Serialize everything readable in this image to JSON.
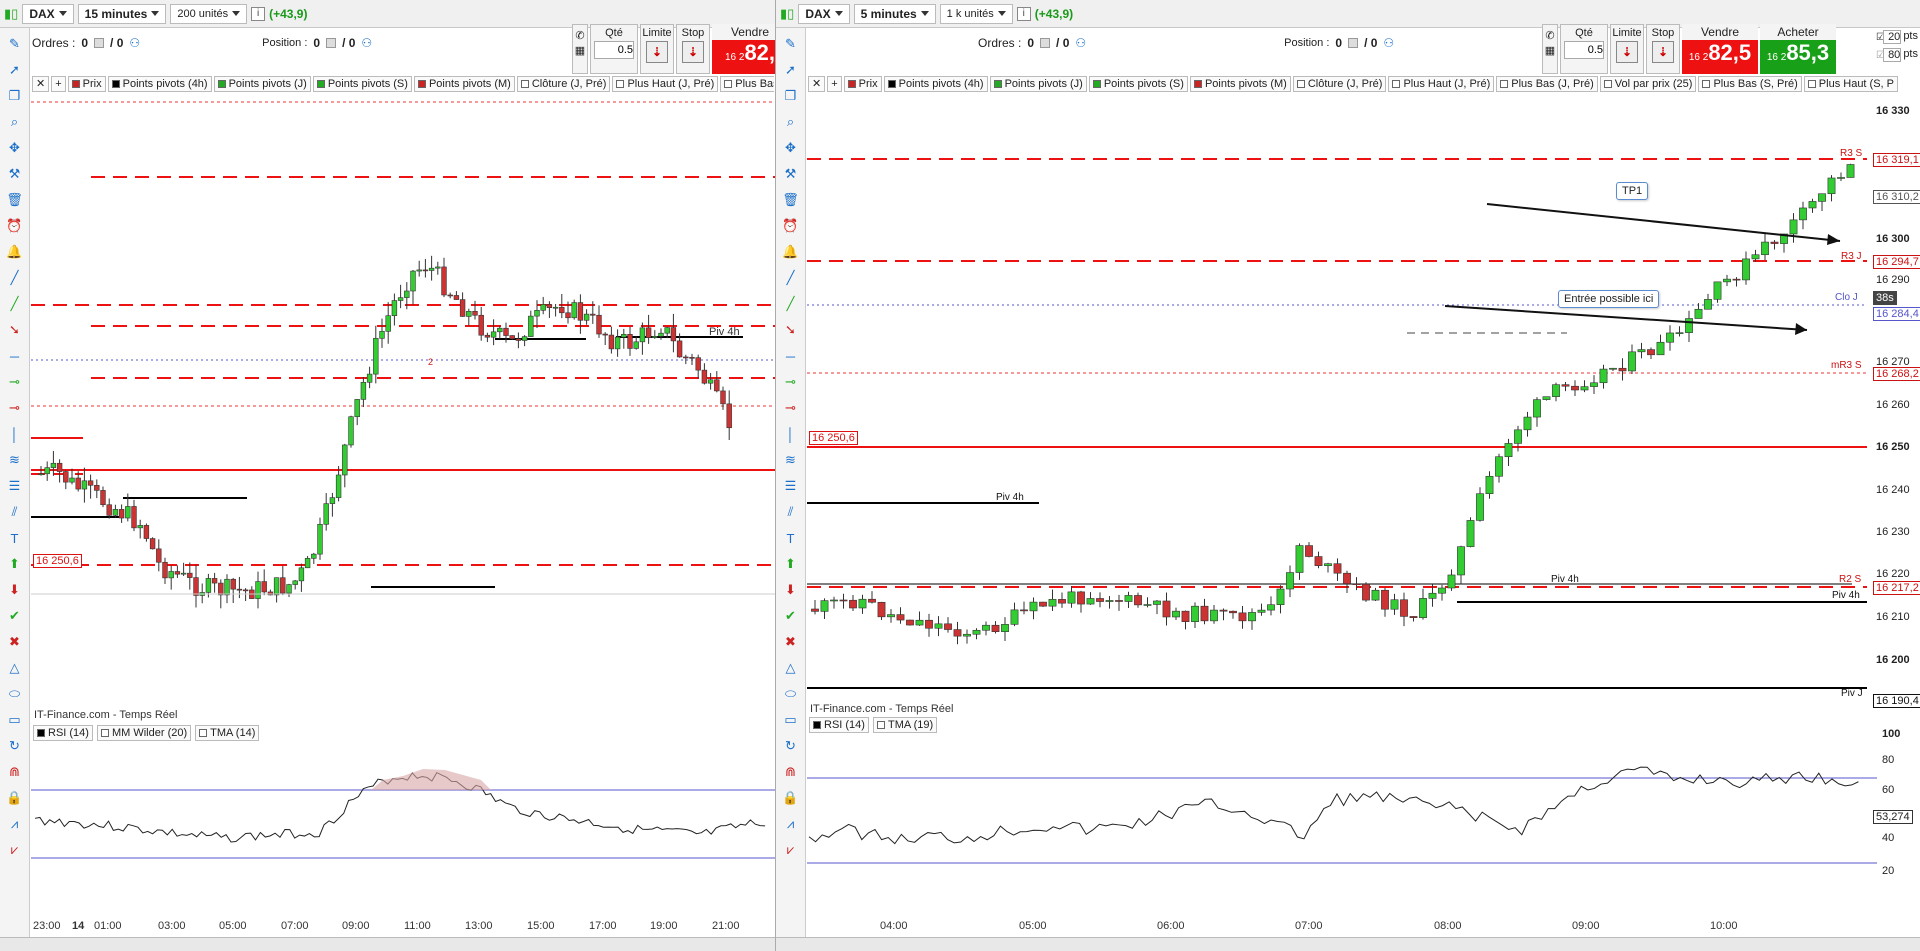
{
  "left": {
    "instrument": "DAX",
    "timeframe": "15 minutes",
    "units": "200 unités",
    "change": "(+43,9)",
    "orders_label": "Ordres :",
    "orders_val": "0",
    "orders_val2": "/ 0",
    "position_label": "Position :",
    "position_val": "0",
    "position_val2": "/ 0",
    "qty_label": "Qté",
    "qty_value": "0.5",
    "limit_label": "Limite",
    "stop_label": "Stop",
    "sell_label": "Vendre",
    "sell_prefix": "16 2",
    "sell_price": "82,",
    "indicators": [
      "Prix",
      "Points pivots (4h)",
      "Points pivots (J)",
      "Points pivots (S)",
      "Points pivots (M)",
      "Clôture (J, Pré)",
      "Plus Haut (J, Pré)",
      "Plus Bas (J"
    ],
    "price_tag": "16 250,6",
    "label_piv4h": "Piv 4h",
    "source": "IT-Finance.com - Temps Réel",
    "rsi_chips": [
      "RSI (14)",
      "MM Wilder (20)",
      "TMA (14)"
    ],
    "time_labels": [
      "23:00",
      "14",
      "01:00",
      "03:00",
      "05:00",
      "07:00",
      "09:00",
      "11:00",
      "13:00",
      "15:00",
      "17:00",
      "19:00",
      "21:00"
    ],
    "signal_num": "2"
  },
  "right": {
    "instrument": "DAX",
    "timeframe": "5 minutes",
    "units": "1 k unités",
    "change": "(+43,9)",
    "orders_label": "Ordres :",
    "orders_val": "0",
    "orders_val2": "/ 0",
    "position_label": "Position :",
    "position_val": "0",
    "position_val2": "/ 0",
    "qty_label": "Qté",
    "qty_value": "0.5",
    "limit_label": "Limite",
    "stop_label": "Stop",
    "sell_label": "Vendre",
    "sell_prefix": "16 2",
    "sell_price": "82,5",
    "buy_label": "Acheter",
    "buy_prefix": "16 2",
    "buy_price": "85,3",
    "side_l": "L",
    "side_sg": "Sg",
    "side_pts1": "20",
    "side_pts2": "80",
    "side_unit": "pts",
    "indicators": [
      "Prix",
      "Points pivots (4h)",
      "Points pivots (J)",
      "Points pivots (S)",
      "Points pivots (M)",
      "Clôture (J, Pré)",
      "Plus Haut (J, Pré)",
      "Plus Bas (J, Pré)",
      "Vol par prix (25)",
      "Plus Bas (S, Pré)",
      "Plus Haut (S, P"
    ],
    "price_axis": [
      "16 330",
      "16 310,2",
      "16 300",
      "16 290",
      "16 284,4",
      "16 270",
      "16 260",
      "16 250",
      "16 240",
      "16 230",
      "16 220",
      "16 210",
      "16 200",
      "16 190,4"
    ],
    "tags": {
      "r3s": "16 319,1",
      "r3j": "16 294,7",
      "cloj": "16 284,4",
      "mr3s": "16 268,2",
      "r2s": "16 217,2",
      "pivj": "16 190,4",
      "timer": "38s",
      "last": "16 310,2"
    },
    "line_labels": {
      "r3s": "R3 S",
      "r3j": "R3 J",
      "cloj": "Clo J",
      "mr3s": "mR3 S",
      "r2s": "R2 S",
      "piv4h": "Piv 4h",
      "piv4h_mid": "Piv 4h",
      "piv4h_left": "Piv 4h",
      "pivj": "Piv J"
    },
    "price_tag": "16 250,6",
    "tp1": "TP1",
    "entry": "Entrée possible ici",
    "source": "IT-Finance.com - Temps Réel",
    "rsi_chips": [
      "RSI (14)",
      "TMA (19)"
    ],
    "rsi_axis": [
      "100",
      "80",
      "60",
      "53,274",
      "40",
      "20"
    ],
    "time_labels": [
      "04:00",
      "05:00",
      "06:00",
      "07:00",
      "08:00",
      "09:00",
      "10:00"
    ]
  }
}
